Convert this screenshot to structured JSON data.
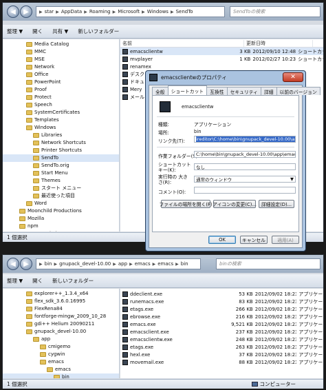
{
  "top_window": {
    "address": [
      "star",
      "AppData",
      "Roaming",
      "Microsoft",
      "Windows",
      "SendTo"
    ],
    "search_placeholder": "SendToの検索",
    "toolbar": [
      "整理 ▼",
      "開く",
      "共有 ▼",
      "新しいフォルダー"
    ],
    "nav_items": [
      {
        "label": "Media Catalog",
        "indent": 1
      },
      {
        "label": "MMC",
        "indent": 1
      },
      {
        "label": "MSE",
        "indent": 1
      },
      {
        "label": "Network",
        "indent": 1
      },
      {
        "label": "Office",
        "indent": 1
      },
      {
        "label": "PowerPoint",
        "indent": 1
      },
      {
        "label": "Proof",
        "indent": 1
      },
      {
        "label": "Protect",
        "indent": 1
      },
      {
        "label": "Speech",
        "indent": 1
      },
      {
        "label": "SystemCertificates",
        "indent": 1
      },
      {
        "label": "Templates",
        "indent": 1
      },
      {
        "label": "Windows",
        "indent": 1
      },
      {
        "label": "Libraries",
        "indent": 2
      },
      {
        "label": "Network Shortcuts",
        "indent": 2
      },
      {
        "label": "Printer Shortcuts",
        "indent": 2
      },
      {
        "label": "SendTo",
        "indent": 2,
        "selected": true
      },
      {
        "label": "SendTo.orig",
        "indent": 2
      },
      {
        "label": "Start Menu",
        "indent": 2
      },
      {
        "label": "Themes",
        "indent": 2
      },
      {
        "label": "スタート メニュー",
        "indent": 2
      },
      {
        "label": "最近使った項目",
        "indent": 2
      },
      {
        "label": "Word",
        "indent": 1
      },
      {
        "label": "Moonchild Productions",
        "indent": 0
      },
      {
        "label": "Mozilla",
        "indent": 0
      },
      {
        "label": "npm",
        "indent": 0
      },
      {
        "label": "PACE Anti-Piracy",
        "indent": 0
      },
      {
        "label": "Pegasys Inc",
        "indent": 0
      }
    ],
    "columns": [
      "名前",
      "更新日時"
    ],
    "files": [
      {
        "name": "emacsclientw",
        "size": "3 KB",
        "date": "2012/09/10 12:48",
        "type": "ショートカット"
      },
      {
        "name": "mvplayer",
        "size": "1 KB",
        "date": "2012/02/27 10:23",
        "type": "ショートカット"
      },
      {
        "name": "renamex",
        "size": "",
        "date": "",
        "type": ""
      },
      {
        "name": "デスク",
        "size": "",
        "date": "",
        "type": ""
      },
      {
        "name": "ドキュメ",
        "size": "",
        "date": "",
        "type": ""
      },
      {
        "name": "Mery",
        "size": "",
        "date": "",
        "type": ""
      },
      {
        "name": "メール",
        "size": "",
        "date": "",
        "type": ""
      }
    ],
    "status": "1 個選択"
  },
  "dialog": {
    "title": "emacsclientwのプロパティ",
    "close": "✕",
    "tabs": [
      "全般",
      "ショートカット",
      "互換性",
      "セキュリティ",
      "詳細",
      "以前のバージョン"
    ],
    "active_tab": "ショートカット",
    "name": "emacsclientw",
    "fields": {
      "type_label": "種類:",
      "type_value": "アプリケーション",
      "location_label": "場所:",
      "location_value": "bin",
      "target_label": "リンク先(T):",
      "target_value": "ireditor\\C:\\home\\bin\\gnupack_devel-10.00\\app\\emacs\\bin\\emacs.exe",
      "workdir_label": "作業フォルダー(S):",
      "workdir_value": "C:\\home\\bin\\gnupack_devel-10.00\\app\\emacs\\bin",
      "shortcut_label": "ショートカット キー(K):",
      "shortcut_value": "なし",
      "run_label": "実行時の 大きさ(R):",
      "run_value": "通常のウィンドウ",
      "comment_label": "コメント(O):",
      "comment_value": ""
    },
    "buttons": {
      "open_location": "ファイルの場所を開く(F)",
      "change_icon": "アイコンの変更(C)...",
      "advanced": "詳細設定(D)...",
      "ok": "OK",
      "cancel": "キャンセル",
      "apply": "適用(A)"
    }
  },
  "bottom_window": {
    "address": [
      "bin",
      "gnupack_devel-10.00",
      "app",
      "emacs",
      "emacs",
      "bin"
    ],
    "search_placeholder": "binの検索",
    "toolbar": [
      "整理 ▼",
      "開く",
      "新しいフォルダー"
    ],
    "nav_items": [
      {
        "label": "explorer++_1.3.4_x64",
        "indent": 1
      },
      {
        "label": "flex_sdk_3.6.0.16995",
        "indent": 1
      },
      {
        "label": "FlexRena84",
        "indent": 1
      },
      {
        "label": "fontforge-mingw_2009_10_28",
        "indent": 1
      },
      {
        "label": "gdi++ Helium 20090211",
        "indent": 1
      },
      {
        "label": "gnupack_devel-10.00",
        "indent": 1
      },
      {
        "label": "app",
        "indent": 2
      },
      {
        "label": "cmigemo",
        "indent": 3
      },
      {
        "label": "cygwin",
        "indent": 3
      },
      {
        "label": "emacs",
        "indent": 3
      },
      {
        "label": "emacs",
        "indent": 4
      },
      {
        "label": "bin",
        "indent": 5,
        "selected": true
      },
      {
        "label": "data",
        "indent": 5
      }
    ],
    "files": [
      {
        "name": "ddeclient.exe",
        "size": "53 KB",
        "date": "2012/09/02 18:23",
        "type": "アプリケー"
      },
      {
        "name": "runemacs.exe",
        "size": "83 KB",
        "date": "2012/09/02 18:23",
        "type": "アプリケー"
      },
      {
        "name": "etags.exe",
        "size": "266 KB",
        "date": "2012/09/02 18:23",
        "type": "アプリケー"
      },
      {
        "name": "ebrowse.exe",
        "size": "216 KB",
        "date": "2012/09/02 18:23",
        "type": "アプリケー"
      },
      {
        "name": "emacs.exe",
        "size": "9,521 KB",
        "date": "2012/09/02 18:23",
        "type": "アプリケー"
      },
      {
        "name": "emacsclient.exe",
        "size": "237 KB",
        "date": "2012/09/02 18:23",
        "type": "アプリケー"
      },
      {
        "name": "emacsclientw.exe",
        "size": "248 KB",
        "date": "2012/09/02 18:23",
        "type": "アプリケー"
      },
      {
        "name": "etags.exe",
        "size": "263 KB",
        "date": "2012/09/02 18:23",
        "type": "アプリケー"
      },
      {
        "name": "hexl.exe",
        "size": "37 KB",
        "date": "2012/09/02 18:23",
        "type": "アプリケー"
      },
      {
        "name": "movemail.exe",
        "size": "88 KB",
        "date": "2012/09/02 18:23",
        "type": "アプリケー"
      }
    ],
    "status": "1 個選択",
    "computer": "コンピューター"
  }
}
